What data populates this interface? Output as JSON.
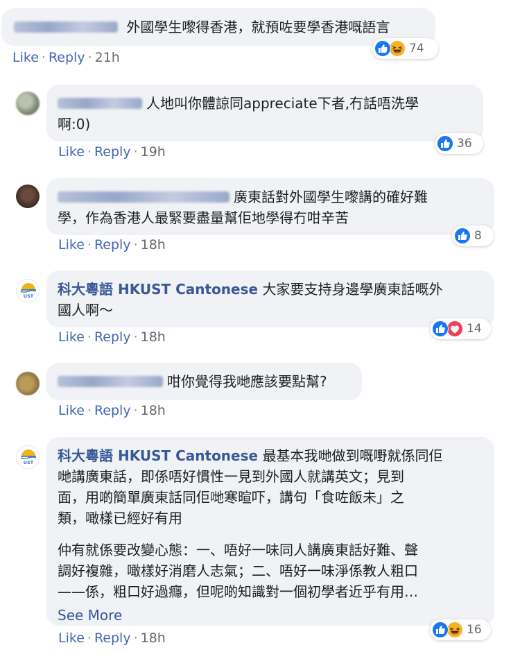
{
  "comments": [
    {
      "text": "外國學生嚟得香港，就預咗要學香港嘅語言",
      "time": "21h",
      "count": "74",
      "reactions": [
        "like-icon",
        "haha-icon"
      ]
    },
    {
      "text_line1": "人地叫你體諒同appreciate下者,冇話唔洗學",
      "text_line2": "啊:0)",
      "time": "19h",
      "count": "36",
      "reactions": [
        "like-icon"
      ]
    },
    {
      "text_line1": "廣東話對外國學生嚟講的確好難",
      "text_line2": "學，作為香港人最緊要盡量幫佢地學得冇咁辛苦",
      "time": "18h",
      "count": "8",
      "reactions": [
        "like-icon"
      ]
    },
    {
      "author": "科大粵語 HKUST Cantonese",
      "text_line1": "大家要支持身邊學廣東話嘅外",
      "text_line2": "國人啊～",
      "time": "18h",
      "count": "14",
      "reactions": [
        "like-icon",
        "love-icon"
      ]
    },
    {
      "text": "咁你覺得我哋應該要點幫?",
      "time": "18h"
    },
    {
      "author": "科大粵語 HKUST Cantonese",
      "text_line1": "最基本我哋做到嘅嘢就係同佢",
      "text_line2": "哋講廣東話，即係唔好慣性一見到外國人就講英文；見到",
      "text_line3": "面，用啲簡單廣東話同佢哋寒暄吓，講句「食咗飯未」之",
      "text_line4": "類，噉樣已經好有用",
      "para2_line1": "仲有就係要改變心態：一、唔好一味同人講廣東話好難、聲",
      "para2_line2": "調好複雜，噉樣好消磨人志氣；二、唔好一味淨係教人粗口",
      "para2_line3": "——係，粗口好過癮，但呢啲知識對一個初學者近乎有用…",
      "see_more": "See More",
      "time": "18h",
      "count": "16",
      "reactions": [
        "like-icon",
        "haha-icon"
      ]
    }
  ],
  "actions": {
    "like": "Like",
    "reply": "Reply",
    "sep": "·"
  },
  "colors": {
    "bubble": "#f0f2f5",
    "link": "#4267b2",
    "page_name": "#385898",
    "like": "#1877f2",
    "haha": "#f7b125",
    "love": "#f33e58"
  }
}
